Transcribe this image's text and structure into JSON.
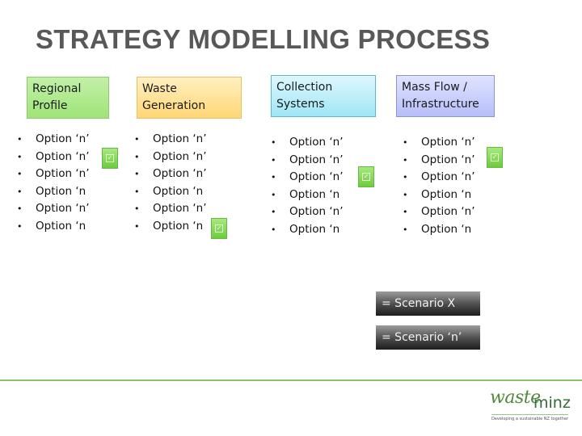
{
  "title": "STRATEGY MODELLING PROCESS",
  "columns": [
    {
      "header_line1": "Regional",
      "header_line2": "Profile",
      "header_color": "#b0ea8e",
      "options": [
        "Option ‘n’",
        "Option ‘n’",
        "Option ‘n’",
        "Option ‘n",
        "Option ‘n’",
        "Option ‘n"
      ],
      "selected_index": 1
    },
    {
      "header_line1": "Waste",
      "header_line2": "Generation",
      "header_color": "#ffe08f",
      "options": [
        "Option ‘n’",
        "Option ‘n’",
        "Option ‘n’",
        "Option ‘n",
        "Option ‘n’",
        "Option ‘n"
      ],
      "selected_index": 5
    },
    {
      "header_line1": "Collection",
      "header_line2": "Systems",
      "header_color": "#b8eefa",
      "options": [
        "Option ‘n’",
        "Option ‘n’",
        "Option ‘n’",
        "Option ‘n",
        "Option ‘n’",
        "Option ‘n"
      ],
      "selected_index": 2
    },
    {
      "header_line1": "Mass Flow /",
      "header_line2": "Infrastructure",
      "header_color": "#c8cdfb",
      "options": [
        "Option ‘n’",
        "Option ‘n’",
        "Option ‘n’",
        "Option ‘n",
        "Option ‘n’",
        "Option ‘n"
      ],
      "selected_index": 1
    }
  ],
  "bullet": "•",
  "check_glyph": "✓",
  "legend": {
    "scenario_x": "= Scenario X",
    "scenario_n": "= Scenario ‘n’"
  },
  "logo": {
    "word1": "waste",
    "word2": "minz",
    "tagline": "Developing a sustainable NZ together"
  },
  "colors": {
    "accent_green": "#8fc267",
    "title_gray": "#585858"
  }
}
